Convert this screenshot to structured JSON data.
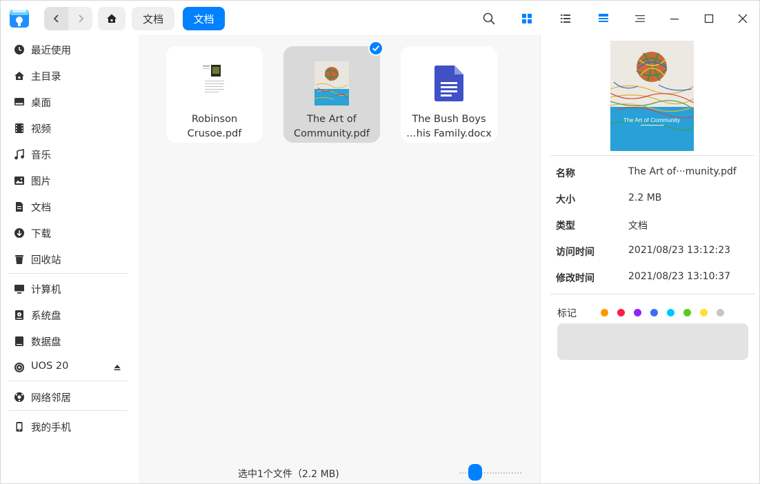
{
  "colors": {
    "accent": "#0081ff",
    "sidebar_bg": "#ffffff",
    "files_bg": "#f7f7f7"
  },
  "breadcrumb": {
    "items": [
      {
        "label": "文档"
      },
      {
        "label": "文档"
      }
    ]
  },
  "toolbar": {
    "icons": [
      "search-icon",
      "icon-view-icon",
      "list-view-icon",
      "detail-view-icon",
      "menu-icon",
      "minimize-icon",
      "maximize-icon",
      "close-icon"
    ]
  },
  "sidebar": {
    "items": [
      {
        "label": "最近使用",
        "icon": "recent-icon"
      },
      {
        "label": "主目录",
        "icon": "home-icon"
      },
      {
        "label": "桌面",
        "icon": "desktop-icon"
      },
      {
        "label": "视频",
        "icon": "video-icon"
      },
      {
        "label": "音乐",
        "icon": "music-icon"
      },
      {
        "label": "图片",
        "icon": "picture-icon"
      },
      {
        "label": "文档",
        "icon": "document-icon"
      },
      {
        "label": "下载",
        "icon": "download-icon"
      },
      {
        "label": "回收站",
        "icon": "trash-icon"
      },
      {
        "label": "计算机",
        "icon": "computer-icon"
      },
      {
        "label": "系统盘",
        "icon": "system-disk-icon"
      },
      {
        "label": "数据盘",
        "icon": "data-disk-icon"
      },
      {
        "label": "UOS 20",
        "icon": "disc-icon"
      },
      {
        "label": "网络邻居",
        "icon": "network-icon"
      },
      {
        "label": "我的手机",
        "icon": "phone-icon"
      }
    ]
  },
  "files": [
    {
      "name_line1": "Robinson",
      "name_line2": "Crusoe.pdf",
      "selected": false
    },
    {
      "name_line1": "The Art of",
      "name_line2": "Community.pdf",
      "selected": true
    },
    {
      "name_line1": "The Bush Boys",
      "name_line2": "…his Family.docx",
      "selected": false
    }
  ],
  "status": {
    "text": "选中1个文件（2.2 MB)",
    "zoom_level": 0.25
  },
  "preview": {
    "cover_title": "The Art of Community"
  },
  "detail": {
    "rows": [
      {
        "key": "名称",
        "value": "The Art of···munity.pdf"
      },
      {
        "key": "大小",
        "value": "2.2 MB"
      },
      {
        "key": "类型",
        "value": "文档"
      },
      {
        "key": "访问时间",
        "value": "2021/08/23 13:12:23"
      },
      {
        "key": "修改时间",
        "value": "2021/08/23 13:10:37"
      }
    ],
    "tag_label": "标记",
    "tag_colors": [
      "#ff9800",
      "#ff1c49",
      "#9023fc",
      "#3d6ef7",
      "#00c6ff",
      "#59cc21",
      "#ffe031",
      "#c6c6c6"
    ]
  }
}
